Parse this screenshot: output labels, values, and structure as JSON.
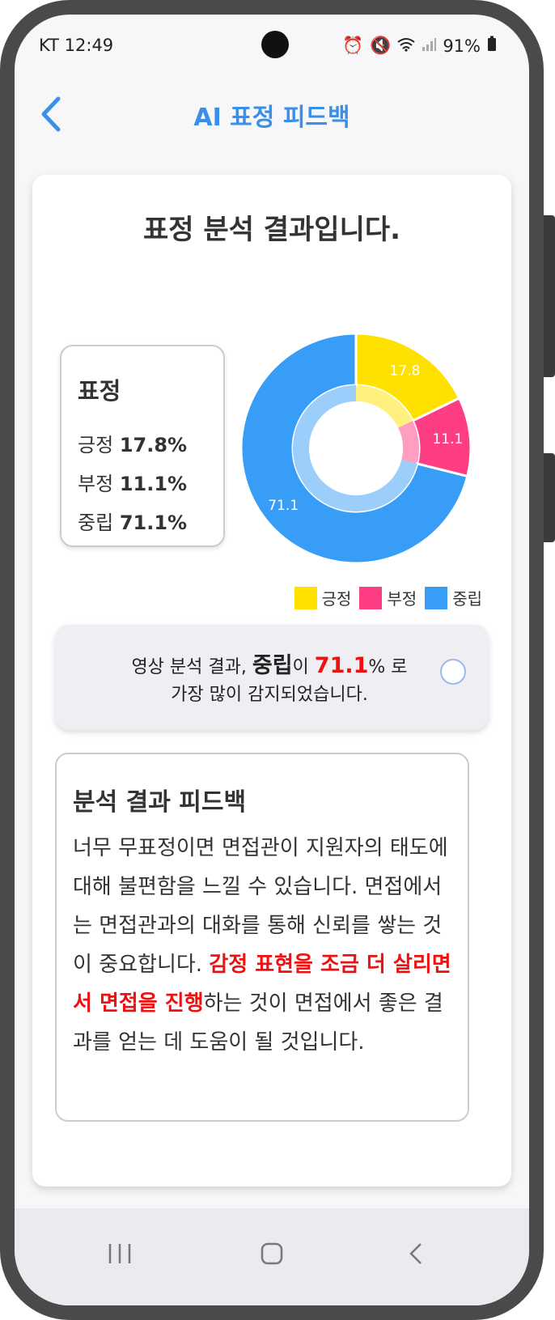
{
  "status_bar": {
    "carrier_time": "KT 12:49",
    "battery": "91%"
  },
  "app_bar": {
    "title": "AI 표정 피드백"
  },
  "heading": "표정 분석 결과입니다.",
  "stats": {
    "title": "표정",
    "rows": [
      {
        "label": "긍정",
        "value": "17.8%"
      },
      {
        "label": "부정",
        "value": "11.1%"
      },
      {
        "label": "중립",
        "value": "71.1%"
      }
    ]
  },
  "chart_data": {
    "type": "pie",
    "series": [
      {
        "name": "긍정",
        "value": 17.8,
        "label": "17.8",
        "color": "#ffe100"
      },
      {
        "name": "부정",
        "value": 11.1,
        "label": "11.1",
        "color": "#ff3d84"
      },
      {
        "name": "중립",
        "value": 71.1,
        "label": "71.1",
        "color": "#389df7"
      }
    ]
  },
  "legend": [
    {
      "label": "긍정",
      "color": "#ffe100"
    },
    {
      "label": "부정",
      "color": "#ff3d84"
    },
    {
      "label": "중립",
      "color": "#389df7"
    }
  ],
  "summary": {
    "prefix": "영상 분석 결과, ",
    "emotion": "중립",
    "mid": "이 ",
    "value": "71.1",
    "suffix": "% 로",
    "line2": "가장 많이 감지되었습니다."
  },
  "feedback": {
    "title": "분석 결과 피드백",
    "body_start": "너무 무표정이면 면접관이 지원자의 태도에 대해 불편함을 느낄 수 있습니다. 면접에서는 면접관과의 대화를 통해 신뢰를 쌓는 것이 중요합니다. ",
    "body_highlight": "감정 표현을 조금 더 살리면서 면접을 진행",
    "body_end": "하는 것이 면접에서 좋은 결과를 얻는 데 도움이 될 것입니다."
  },
  "icons": [
    "back-arrow-icon",
    "radio-icon",
    "recent-apps-icon",
    "home-icon",
    "nav-back-icon"
  ]
}
